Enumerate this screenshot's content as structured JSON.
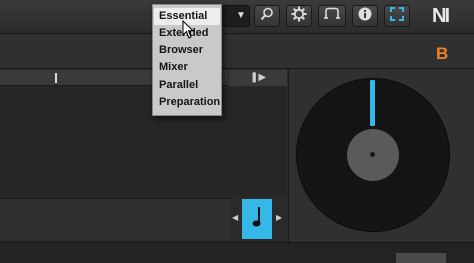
{
  "toolbar": {
    "layout_dropdown": {
      "options": [
        "Essential",
        "Extended",
        "Browser",
        "Mixer",
        "Parallel",
        "Preparation"
      ],
      "selected": "Essential"
    },
    "icons": [
      "search-icon",
      "gear-icon",
      "record-icon",
      "info-icon",
      "fullscreen-icon"
    ],
    "logo": "NI"
  },
  "deck": {
    "letter": "B",
    "accent_color": "#35b8e8",
    "letter_color": "#f0822a"
  }
}
